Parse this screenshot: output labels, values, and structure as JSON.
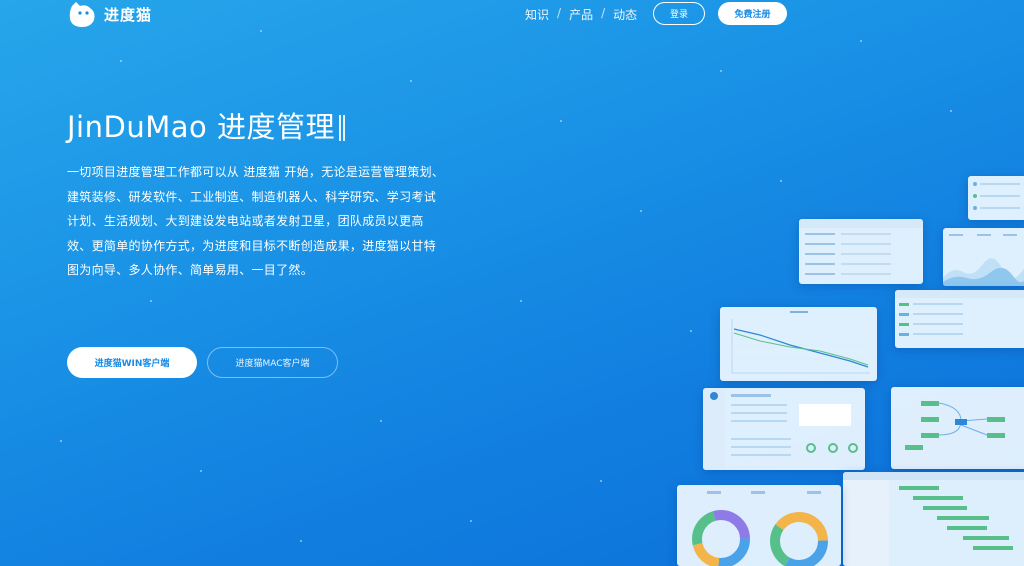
{
  "header": {
    "logo_text": "进度猫",
    "nav": [
      {
        "label": "知识"
      },
      {
        "label": "产品"
      },
      {
        "label": "动态"
      }
    ],
    "nav_separator": "/",
    "login_label": "登录",
    "register_label": "免费注册"
  },
  "hero": {
    "title": "JinDuMao 进度管理",
    "description": "一切项目进度管理工作都可以从 进度猫 开始，无论是运营管理策划、建筑装修、研发软件、工业制造、制造机器人、科学研究、学习考试计划、生活规划、大到建设发电站或者发射卫星，团队成员以更高效、更简单的协作方式，为进度和目标不断创造成果，进度猫以甘特图为向导、多人协作、简单易用、一目了然。",
    "cta_win": "进度猫WIN客户端",
    "cta_mac": "进度猫MAC客户端"
  },
  "colors": {
    "bg_top": "#27a6ea",
    "bg_bottom": "#0b6fd9",
    "accent": "#1a8ce6",
    "white": "#ffffff"
  },
  "icons": [
    "cat-logo-icon"
  ]
}
